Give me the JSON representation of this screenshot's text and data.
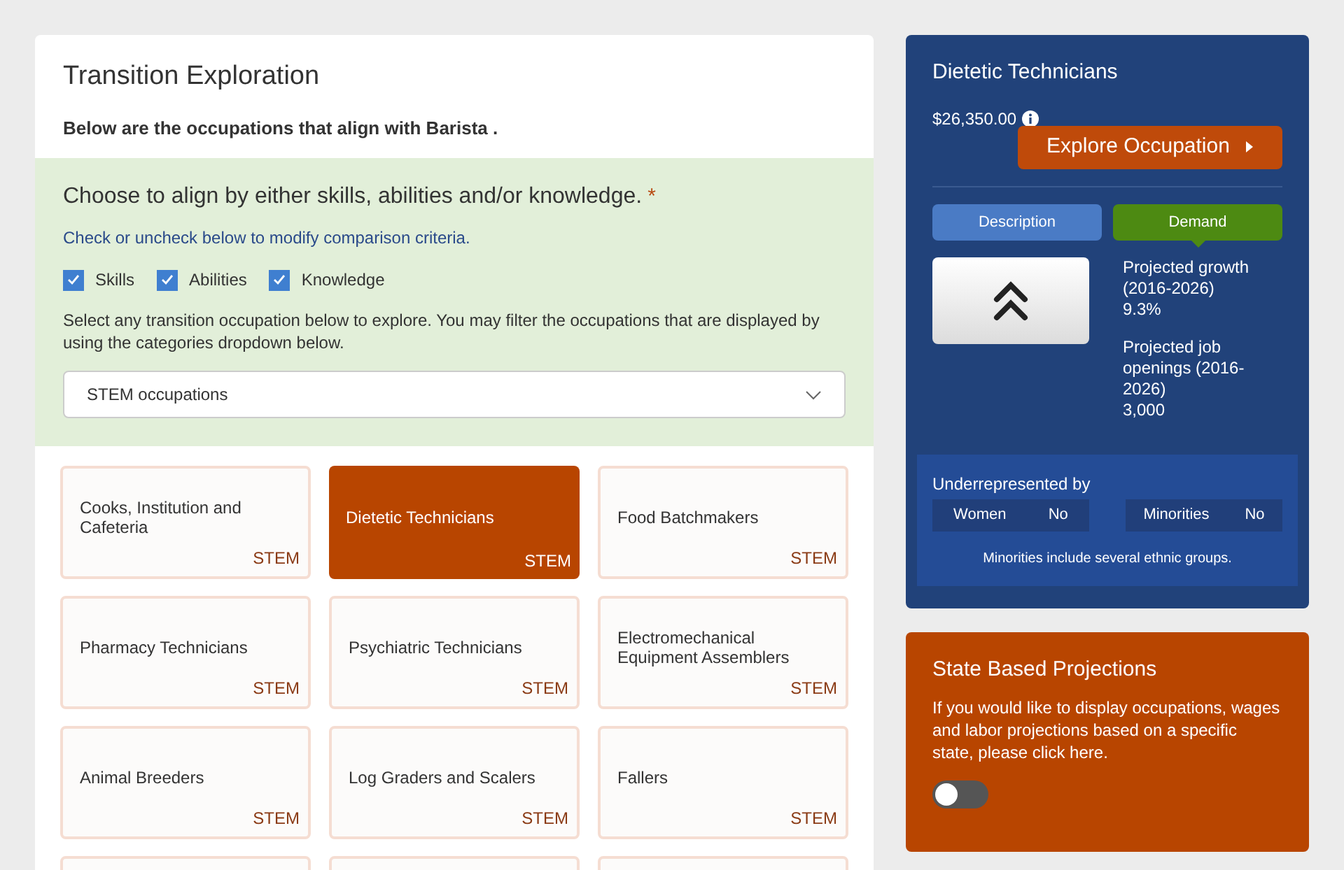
{
  "main": {
    "title": "Transition Exploration",
    "subtitle": "Below are the occupations that align with Barista .",
    "align": {
      "heading": "Choose to align by either skills, abilities and/or knowledge.",
      "required_mark": "*",
      "hint": "Check or uncheck below to modify comparison criteria.",
      "criteria": [
        {
          "label": "Skills",
          "checked": true
        },
        {
          "label": "Abilities",
          "checked": true
        },
        {
          "label": "Knowledge",
          "checked": true
        }
      ],
      "instructions": "Select any transition occupation below to explore. You may filter the occupations that are displayed by using the categories dropdown below.",
      "dropdown": {
        "value": "STEM occupations"
      }
    },
    "occupations": [
      {
        "name": "Cooks, Institution and Cafeteria",
        "tag": "STEM",
        "selected": false
      },
      {
        "name": "Dietetic Technicians",
        "tag": "STEM",
        "selected": true
      },
      {
        "name": "Food Batchmakers",
        "tag": "STEM",
        "selected": false
      },
      {
        "name": "Pharmacy Technicians",
        "tag": "STEM",
        "selected": false
      },
      {
        "name": "Psychiatric Technicians",
        "tag": "STEM",
        "selected": false
      },
      {
        "name": "Electromechanical Equipment Assemblers",
        "tag": "STEM",
        "selected": false
      },
      {
        "name": "Animal Breeders",
        "tag": "STEM",
        "selected": false
      },
      {
        "name": "Log Graders and Scalers",
        "tag": "STEM",
        "selected": false
      },
      {
        "name": "Fallers",
        "tag": "STEM",
        "selected": false
      }
    ]
  },
  "detail": {
    "title": "Dietetic Technicians",
    "wage": "$26,350.00",
    "explore_button": "Explore Occupation",
    "tabs": [
      {
        "label": "Description",
        "selected": false
      },
      {
        "label": "Demand",
        "selected": true
      }
    ],
    "stats": [
      {
        "label": "Projected growth (2016-2026)",
        "value": "9.3%"
      },
      {
        "label": "Projected job openings (2016-2026)",
        "value": "3,000"
      }
    ],
    "underrepresented": {
      "heading": "Underrepresented by",
      "groups": [
        {
          "label": "Women",
          "value": "No"
        },
        {
          "label": "Minorities",
          "value": "No"
        }
      ],
      "note": "Minorities include several ethnic groups."
    }
  },
  "state_projections": {
    "title": "State Based Projections",
    "text": "If you would like to display occupations, wages and labor projections based on a specific state, please click here.",
    "toggle": {
      "on": false
    }
  }
}
